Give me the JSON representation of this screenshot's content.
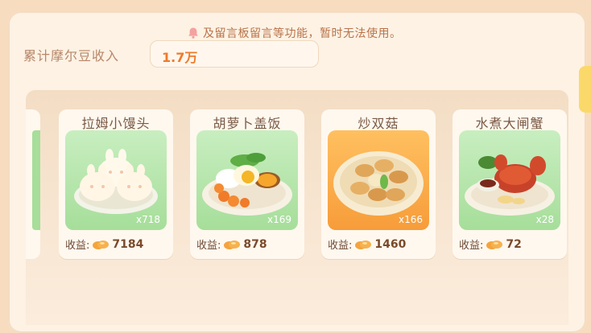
{
  "notice": {
    "text": "及留言板留言等功能，暂时无法使用。"
  },
  "income": {
    "label": "累计摩尔豆收入",
    "value": "1.7万"
  },
  "dishes": [
    {
      "name": "拉姆小馒头",
      "quantity": "x718",
      "earn_label": "收益:",
      "earn_value": "7184",
      "bg": "green"
    },
    {
      "name": "胡萝卜盖饭",
      "quantity": "x169",
      "earn_label": "收益:",
      "earn_value": "878",
      "bg": "green"
    },
    {
      "name": "炒双菇",
      "quantity": "x166",
      "earn_label": "收益:",
      "earn_value": "1460",
      "bg": "orange"
    },
    {
      "name": "水煮大闸蟹",
      "quantity": "x28",
      "earn_label": "收益:",
      "earn_value": "72",
      "bg": "green"
    }
  ],
  "icons": {
    "notice": "bell-icon",
    "currency": "mole-bean-icon"
  }
}
